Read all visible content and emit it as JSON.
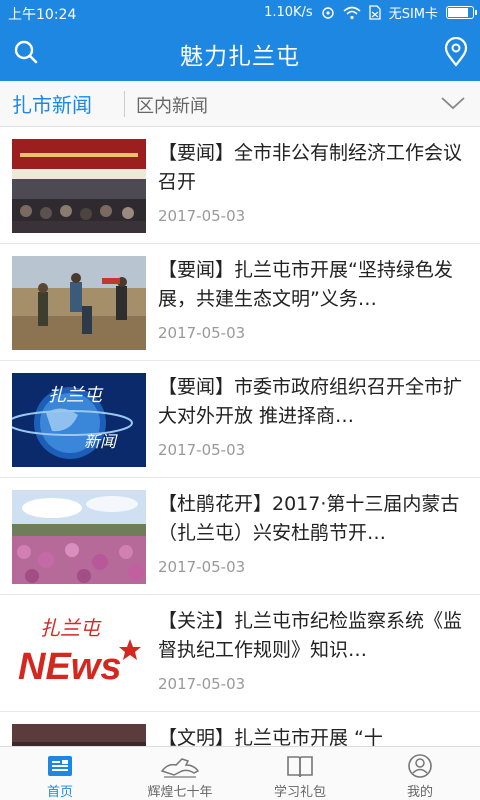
{
  "status_bar": {
    "time": "上午10:24",
    "speed": "1.10K/s",
    "sim": "无SIM卡",
    "battery_level": 0.85
  },
  "app_bar": {
    "title": "魅力扎兰屯",
    "left_icon": "search-icon",
    "right_icon": "location-icon"
  },
  "tabs": {
    "items": [
      "扎市新闻",
      "区内新闻"
    ],
    "active": 0,
    "expand_icon": "chevron-down-icon"
  },
  "news": [
    {
      "title": "【要闻】全市非公有制经济工作会议召开",
      "date": "2017-05-03"
    },
    {
      "title": "【要闻】扎兰屯市开展“坚持绿色发展，共建生态文明”义务…",
      "date": "2017-05-03"
    },
    {
      "title": "【要闻】市委市政府组织召开全市扩大对外开放 推进择商…",
      "date": "2017-05-03"
    },
    {
      "title": "【杜鹃花开】2017·第十三届内蒙古（扎兰屯）兴安杜鹃节开…",
      "date": "2017-05-03"
    },
    {
      "title": "【关注】扎兰屯市纪检监察系统《监督执纪工作规则》知识…",
      "date": "2017-05-03"
    },
    {
      "title": "【文明】扎兰屯市开展 “十",
      "date": ""
    }
  ],
  "thumb_text": {
    "news3_line1": "扎兰屯",
    "news3_line2": "新闻",
    "news5_brand": "扎兰屯",
    "news5_logo": "NEws"
  },
  "bottom_nav": {
    "items": [
      {
        "label": "首页",
        "icon": "home-news-icon"
      },
      {
        "label": "辉煌七十年",
        "icon": "horse-icon"
      },
      {
        "label": "学习礼包",
        "icon": "book-icon"
      },
      {
        "label": "我的",
        "icon": "user-icon"
      }
    ],
    "active": 0
  },
  "colors": {
    "primary": "#1e87e2",
    "text": "#222222",
    "muted": "#999999"
  }
}
